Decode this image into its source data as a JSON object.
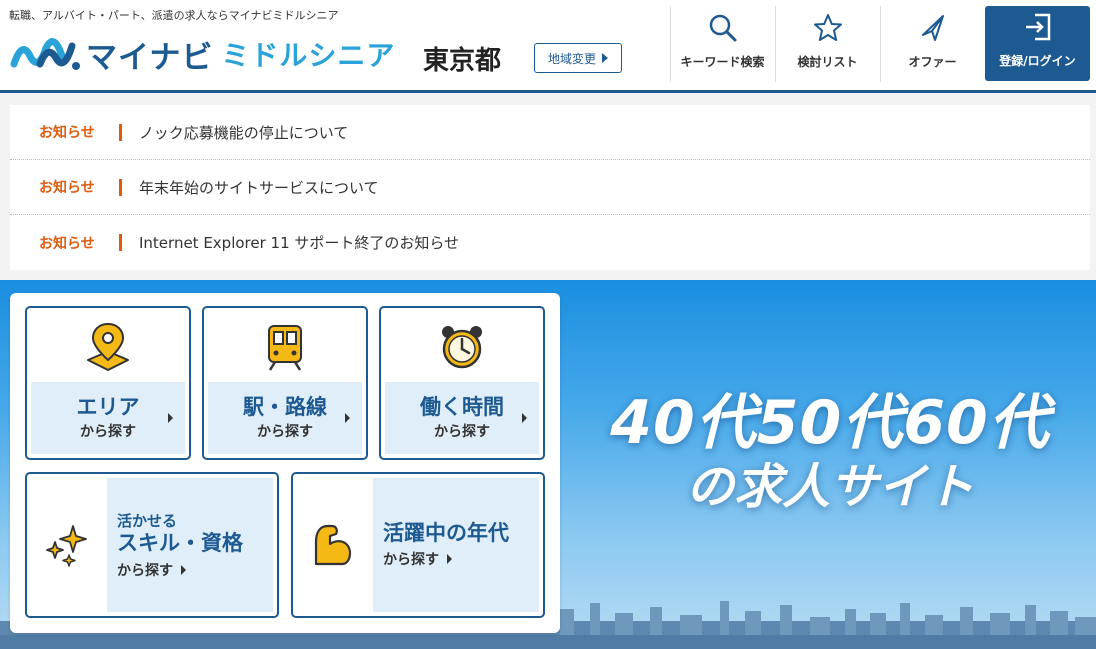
{
  "header": {
    "tagline": "転職、アルバイト・パート、派遣の求人ならマイナビミドルシニア",
    "logo_text_main": "マイナビ",
    "logo_text_sub": "ミドルシニア",
    "region": "東京都",
    "region_change": "地域変更",
    "nav": {
      "keyword": "キーワード検索",
      "list": "検討リスト",
      "offer": "オファー",
      "login": "登録/ログイン"
    }
  },
  "notices": [
    {
      "tag": "お知らせ",
      "text": "ノック応募機能の停止について"
    },
    {
      "tag": "お知らせ",
      "text": "年末年始のサイトサービスについて"
    },
    {
      "tag": "お知らせ",
      "text": "Internet Explorer 11 サポート終了のお知らせ"
    }
  ],
  "search": {
    "area": {
      "title": "エリア",
      "sub": "から探す"
    },
    "station": {
      "title": "駅・路線",
      "sub": "から探す"
    },
    "time": {
      "title": "働く時間",
      "sub": "から探す"
    },
    "skill": {
      "small": "活かせる",
      "big": "スキル・資格",
      "sub": "から探す"
    },
    "age": {
      "big": "活躍中の年代",
      "sub": "から探す"
    }
  },
  "hero": {
    "line1": "40代50代60代",
    "line2": "の求人サイト"
  },
  "colors": {
    "brand": "#1e5a92",
    "accent": "#e05a0f",
    "icon_yellow": "#f5b915"
  },
  "icons": {
    "keyword": "search-icon",
    "list": "star-icon",
    "offer": "paper-plane-icon",
    "login": "login-icon",
    "area": "map-pin-icon",
    "station": "train-icon",
    "time": "alarm-clock-icon",
    "skill": "sparkles-icon",
    "age": "flexed-arm-icon"
  }
}
